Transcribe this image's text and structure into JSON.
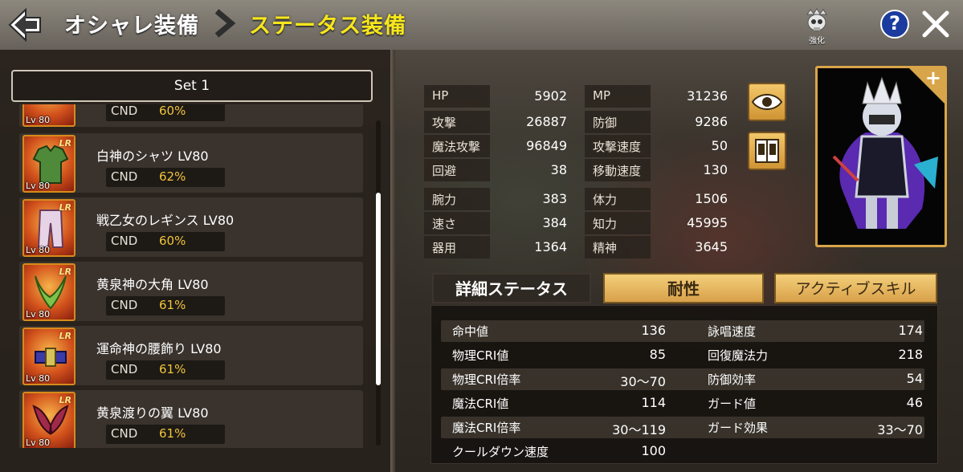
{
  "header": {
    "breadcrumb_parent": "オシャレ装備",
    "breadcrumb_current": "ステータス装備",
    "enhance_label": "強化",
    "help_label": "?"
  },
  "set_selector": {
    "value": "Set 1"
  },
  "equipment_list": [
    {
      "name": "",
      "level_badge": "Lv 80",
      "cnd_label": "CND",
      "cnd_value": "60%",
      "partial": true
    },
    {
      "name": "白神のシャツ LV80",
      "level_badge": "Lv 80",
      "rarity": "LR",
      "cnd_label": "CND",
      "cnd_value": "62%"
    },
    {
      "name": "戦乙女のレギンス LV80",
      "level_badge": "Lv 80",
      "rarity": "LR",
      "cnd_label": "CND",
      "cnd_value": "60%"
    },
    {
      "name": "黄泉神の大角 LV80",
      "level_badge": "Lv 80",
      "rarity": "LR",
      "cnd_label": "CND",
      "cnd_value": "61%"
    },
    {
      "name": "運命神の腰飾り LV80",
      "level_badge": "Lv 80",
      "rarity": "LR",
      "cnd_label": "CND",
      "cnd_value": "61%"
    },
    {
      "name": "黄泉渡りの翼 LV80",
      "level_badge": "Lv 80",
      "rarity": "LR",
      "cnd_label": "CND",
      "cnd_value": "61%"
    }
  ],
  "base_stats": [
    {
      "name": "HP",
      "value": "5902"
    },
    {
      "name": "MP",
      "value": "31236"
    },
    {
      "name": "攻撃",
      "value": "26887"
    },
    {
      "name": "防御",
      "value": "9286"
    },
    {
      "name": "魔法攻撃",
      "value": "96849"
    },
    {
      "name": "攻撃速度",
      "value": "50"
    },
    {
      "name": "回避",
      "value": "38"
    },
    {
      "name": "移動速度",
      "value": "130"
    },
    {
      "name": "腕力",
      "value": "383"
    },
    {
      "name": "体力",
      "value": "1506"
    },
    {
      "name": "速さ",
      "value": "384"
    },
    {
      "name": "知力",
      "value": "45995"
    },
    {
      "name": "器用",
      "value": "1364"
    },
    {
      "name": "精神",
      "value": "3645"
    }
  ],
  "tabs": {
    "detail": "詳細ステータス",
    "resist": "耐性",
    "active_skill": "アクティブスキル"
  },
  "detail_stats": [
    {
      "name": "命中値",
      "value": "136"
    },
    {
      "name": "詠唱速度",
      "value": "174"
    },
    {
      "name": "物理CRI値",
      "value": "85"
    },
    {
      "name": "回復魔法力",
      "value": "218"
    },
    {
      "name": "物理CRI倍率",
      "value": "30～70"
    },
    {
      "name": "防御効率",
      "value": "54"
    },
    {
      "name": "魔法CRI値",
      "value": "114"
    },
    {
      "name": "ガード値",
      "value": "46"
    },
    {
      "name": "魔法CRI倍率",
      "value": "30～119"
    },
    {
      "name": "ガード効果",
      "value": "33～70"
    },
    {
      "name": "クールダウン速度",
      "value": "100"
    }
  ],
  "colors": {
    "accent_gold": "#d9a04a",
    "breadcrumb_current": "#f7e61a",
    "cnd_value": "#f2c53a",
    "help_blue": "#1b3c9e"
  },
  "icons": {
    "back": "back-arrow-icon",
    "separator": "chevron-right-icon",
    "enhance": "skull-crown-icon",
    "close": "close-icon",
    "view": "eye-icon",
    "info": "book-icon",
    "portrait_add": "plus-icon"
  }
}
